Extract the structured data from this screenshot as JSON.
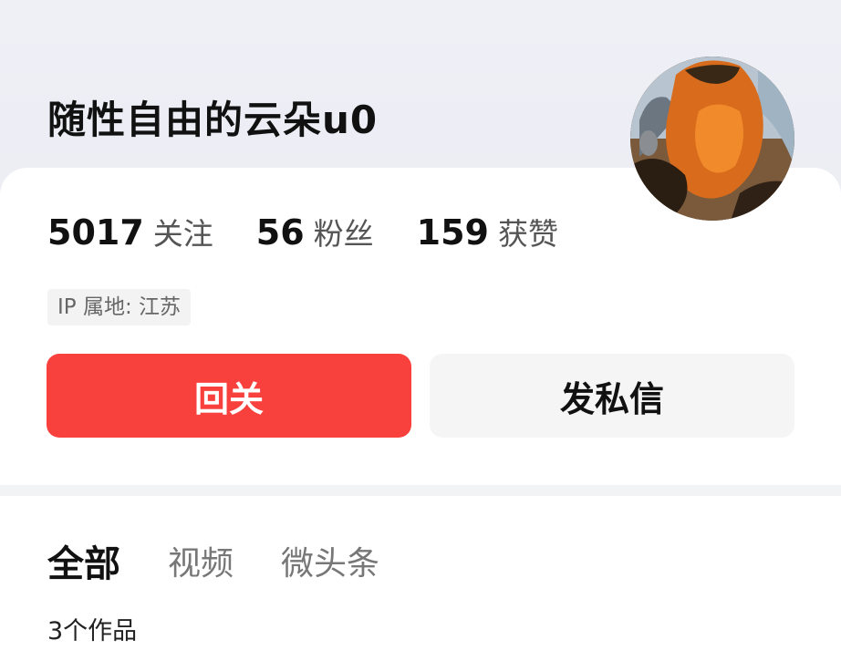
{
  "profile": {
    "username": "随性自由的云朵u0",
    "ip_location": "IP 属地: 江苏"
  },
  "stats": [
    {
      "value": "5017",
      "label": "关注"
    },
    {
      "value": "56",
      "label": "粉丝"
    },
    {
      "value": "159",
      "label": "获赞"
    }
  ],
  "actions": {
    "follow_back_label": "回关",
    "message_label": "发私信"
  },
  "tabs": [
    {
      "label": "全部",
      "active": true
    },
    {
      "label": "视频",
      "active": false
    },
    {
      "label": "微头条",
      "active": false
    }
  ],
  "works_count": "3个作品",
  "colors": {
    "accent": "#f8413d",
    "header_bg": "#eef0f6",
    "divider": "#f2f3f5"
  },
  "icons": {
    "avatar": "avatar-image"
  }
}
